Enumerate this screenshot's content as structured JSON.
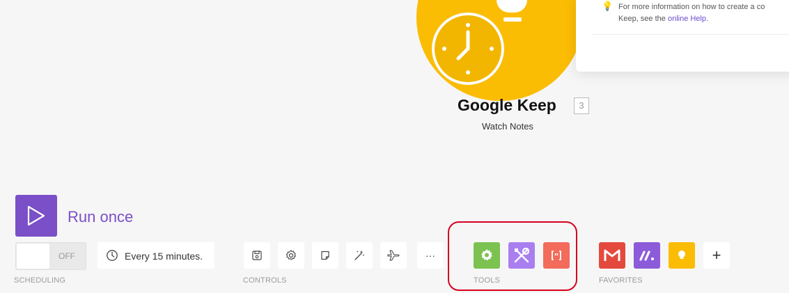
{
  "module": {
    "title": "Google Keep",
    "badge": "3",
    "subtitle": "Watch Notes",
    "color": "#fbbc04"
  },
  "help": {
    "text_line1": "For more information on how to create a co",
    "text_line2_prefix": "Keep, see the ",
    "link_text": "online Help.",
    "icon": "lightbulb-icon"
  },
  "run": {
    "label": "Run once",
    "icon": "play-icon",
    "color": "#7a4fc7"
  },
  "scheduling": {
    "toggle_state": "OFF",
    "interval": "Every 15 minutes.",
    "caption": "SCHEDULING"
  },
  "controls": {
    "caption": "CONTROLS",
    "buttons": [
      "save-icon",
      "gear-icon",
      "note-icon",
      "magic-wand-icon",
      "airplane-icon",
      "more-icon"
    ],
    "more_label": "···"
  },
  "tools": {
    "caption": "TOOLS",
    "items": [
      {
        "icon": "flow-control-gear-icon",
        "color": "#7bc250"
      },
      {
        "icon": "tools-icon",
        "color": "#a97ff0"
      },
      {
        "icon": "text-parser-icon",
        "color": "#f26b5b"
      }
    ]
  },
  "favorites": {
    "caption": "FAVORITES",
    "items": [
      {
        "icon": "gmail-icon",
        "color": "#e34a3d"
      },
      {
        "icon": "make-icon",
        "color": "#8c5bd9"
      },
      {
        "icon": "google-keep-icon",
        "color": "#fbbc04"
      }
    ],
    "add_label": "+"
  }
}
